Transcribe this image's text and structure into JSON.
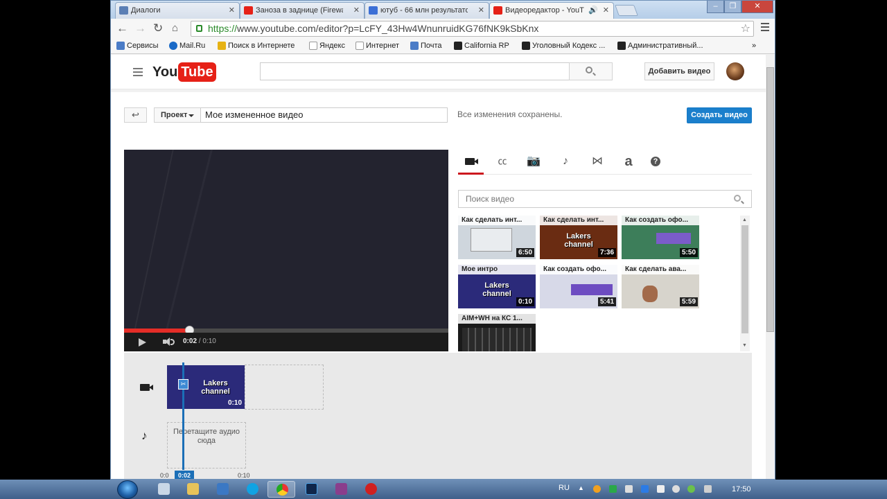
{
  "browser": {
    "tabs": [
      {
        "label": "Диалоги",
        "color": "#5b7fb5"
      },
      {
        "label": "Заноза в заднице (Firewa",
        "color": "#e62117"
      },
      {
        "label": "ютуб - 66 млн результато",
        "color": "#3b6fd6"
      },
      {
        "label": "Видеоредактор - YouT",
        "color": "#e62117"
      }
    ],
    "url_scheme": "https://",
    "url_rest": "www.youtube.com/editor?p=LcFY_43Hw4WnunruidKG76fNK9kSbKnx",
    "bookmarks": [
      {
        "label": "Сервисы",
        "color": "#4b7cc7"
      },
      {
        "label": "Mail.Ru",
        "color": "#1a6ac7"
      },
      {
        "label": "Поиск в Интернете",
        "color": "#e6b214"
      },
      {
        "label": "Яндекс",
        "color": "#dddddd"
      },
      {
        "label": "Интернет",
        "color": "#dddddd"
      },
      {
        "label": "Почта",
        "color": "#4b7cc7"
      },
      {
        "label": "California RP",
        "color": "#222222"
      },
      {
        "label": "Уголовный Кодекс ...",
        "color": "#222222"
      },
      {
        "label": "Административный...",
        "color": "#222222"
      }
    ],
    "more": "»"
  },
  "youtube": {
    "logo_you": "You",
    "logo_tube": "Tube",
    "search_placeholder": "",
    "upload_label": "Добавить видео"
  },
  "editor": {
    "back_glyph": "↩",
    "project_label": "Проект",
    "title_value": "Мое измененное видео",
    "saved_status": "Все изменения сохранены.",
    "create_label": "Создать видео",
    "player": {
      "progress_fraction": 0.2,
      "time_current": "0:02",
      "time_total": "0:10"
    },
    "tools": [
      {
        "name": "video"
      },
      {
        "name": "cc",
        "glyph": "㏄"
      },
      {
        "name": "photo"
      },
      {
        "name": "music",
        "glyph": "♪"
      },
      {
        "name": "transitions",
        "glyph": "⋈"
      },
      {
        "name": "text",
        "glyph": "a"
      },
      {
        "name": "help",
        "glyph": "?"
      }
    ],
    "video_search_placeholder": "Поиск видео",
    "library": [
      {
        "title": "Как сделать инт...",
        "duration": "6:50",
        "bg": "#cfd6dd",
        "logo": ""
      },
      {
        "title": "Как сделать инт...",
        "duration": "7:36",
        "bg": "#6a2c12",
        "logo": "Lakers\nchannel"
      },
      {
        "title": "Как создать офо...",
        "duration": "5:50",
        "bg": "#3d7e5a",
        "logo": ""
      },
      {
        "title": "Мое интро",
        "duration": "0:10",
        "bg": "#2b2a7a",
        "logo": "Lakers\nchannel"
      },
      {
        "title": "Как создать офо...",
        "duration": "5:41",
        "bg": "#8a73c9",
        "logo": ""
      },
      {
        "title": "Как сделать ава...",
        "duration": "5:59",
        "bg": "#d7d4cc",
        "logo": ""
      },
      {
        "title": "AIM+WH на КС 1...",
        "duration": "",
        "bg": "#1a1a1a",
        "logo": ""
      }
    ],
    "timeline": {
      "clip_duration": "0:10",
      "drop_audio": "Перетащите аудио сюда",
      "start_label": "0:0",
      "current_label": "0:02",
      "end_label": "0:10",
      "clip_logo": "Lakers\nchannel"
    }
  },
  "taskbar": {
    "lang": "RU",
    "clock": "17:50"
  }
}
